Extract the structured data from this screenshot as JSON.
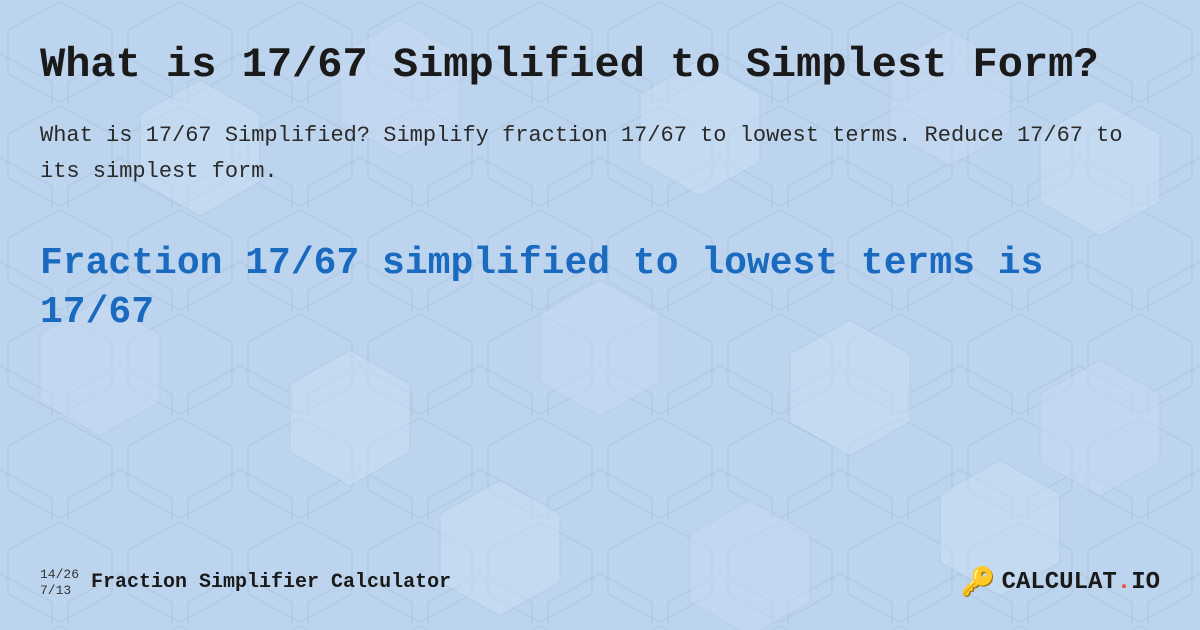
{
  "background": {
    "color": "#c8ddf5"
  },
  "header": {
    "title": "What is 17/67 Simplified to Simplest Form?"
  },
  "description": {
    "text": "What is 17/67 Simplified? Simplify fraction 17/67 to lowest terms. Reduce 17/67 to its simplest form."
  },
  "result": {
    "text": "Fraction 17/67 simplified to lowest terms is 17/67"
  },
  "footer": {
    "fraction1": "14/26",
    "fraction2": "7/13",
    "label": "Fraction Simplifier Calculator",
    "logo_text": "CALCULAT.IO"
  }
}
